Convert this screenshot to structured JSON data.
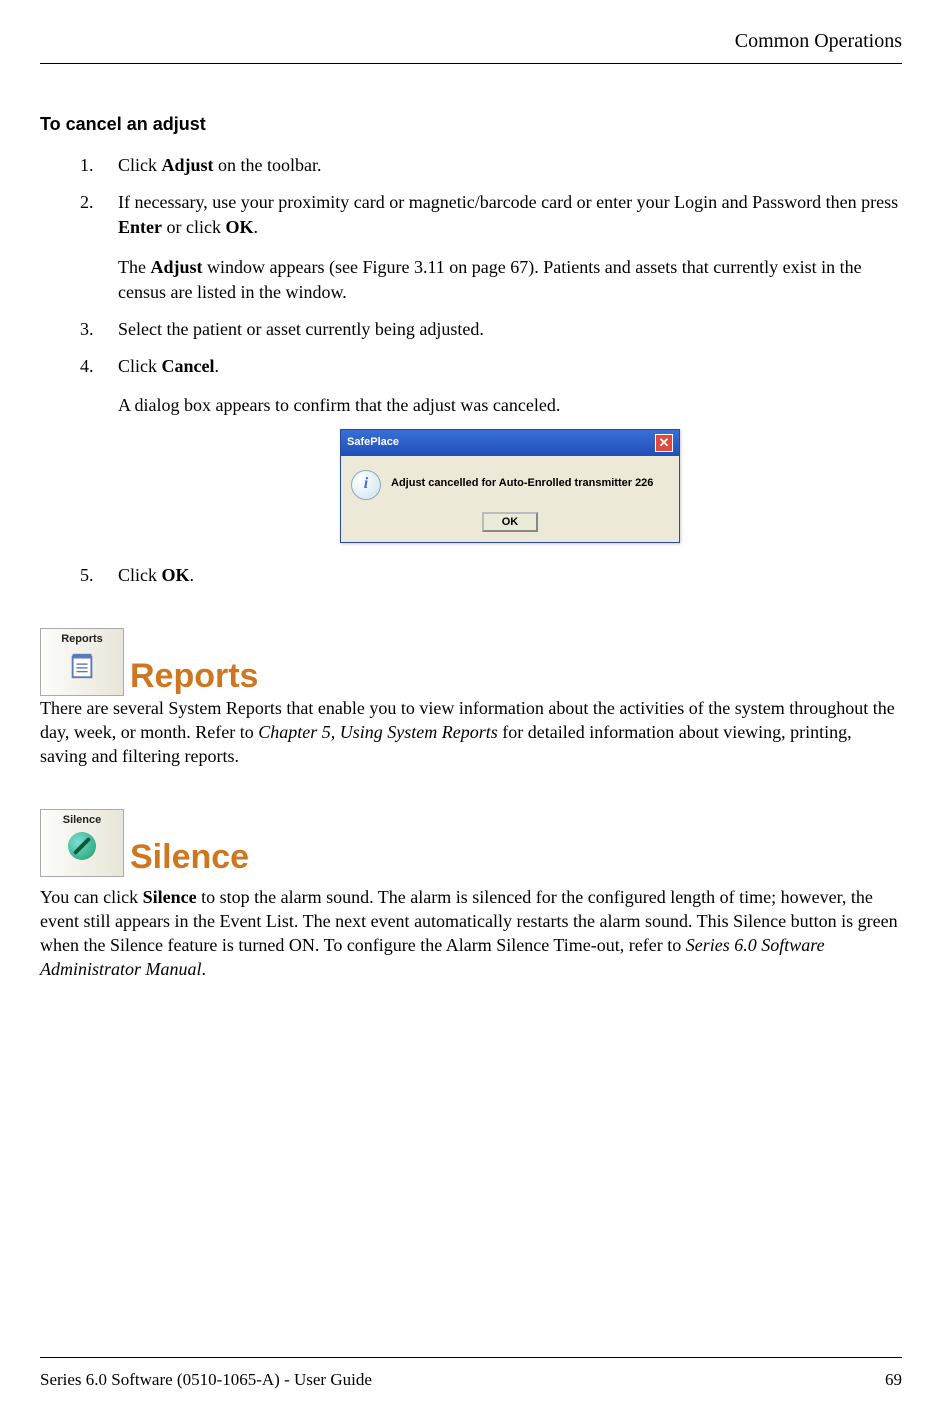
{
  "header": {
    "chapter": "Common Operations"
  },
  "cancel_adjust": {
    "heading": "To cancel an adjust",
    "steps": {
      "s1": {
        "t1": "Click ",
        "b1": "Adjust",
        "t2": " on the toolbar."
      },
      "s2": {
        "t1": "If necessary, use your proximity card or magnetic/barcode card or enter your Login and Password then press ",
        "b1": "Enter",
        "t2": " or click ",
        "b2": "OK",
        "t3": ".",
        "extra_t1": "The ",
        "extra_b1": "Adjust",
        "extra_t2": " window appears (see Figure 3.11 on page 67). Patients and assets that currently exist in the census are listed in the window."
      },
      "s3": {
        "t1": "Select the patient or asset currently being adjusted."
      },
      "s4": {
        "t1": "Click ",
        "b1": "Cancel",
        "t2": ".",
        "extra": "A dialog box appears to confirm that the adjust was canceled."
      },
      "s5": {
        "t1": "Click ",
        "b1": "OK",
        "t2": "."
      }
    }
  },
  "dialog": {
    "title": "SafePlace",
    "message": "Adjust cancelled for Auto-Enrolled transmitter 226",
    "ok": "OK"
  },
  "reports": {
    "btn_label": "Reports",
    "heading": "Reports",
    "para_t1": "There are several System Reports that enable you to view information about the activities of the system throughout the day, week, or month. Refer to ",
    "para_i1": "Chapter 5, Using System Reports",
    "para_t2": " for detailed information about viewing, printing, saving and filtering reports."
  },
  "silence": {
    "btn_label": "Silence",
    "heading": "Silence",
    "para_t1": "You can click ",
    "para_b1": "Silence",
    "para_t2": " to stop the alarm sound. The alarm is silenced for the configured length of time; however, the event still appears in the Event List. The next event automatically restarts the alarm sound. This Silence button is green when the Silence feature is turned ON. To configure the Alarm Silence Time-out, refer to ",
    "para_i1": "Series 6.0 Software Administrator Manual",
    "para_t3": "."
  },
  "footer": {
    "left": "Series 6.0 Software (0510-1065-A) - User Guide",
    "right": "69"
  }
}
